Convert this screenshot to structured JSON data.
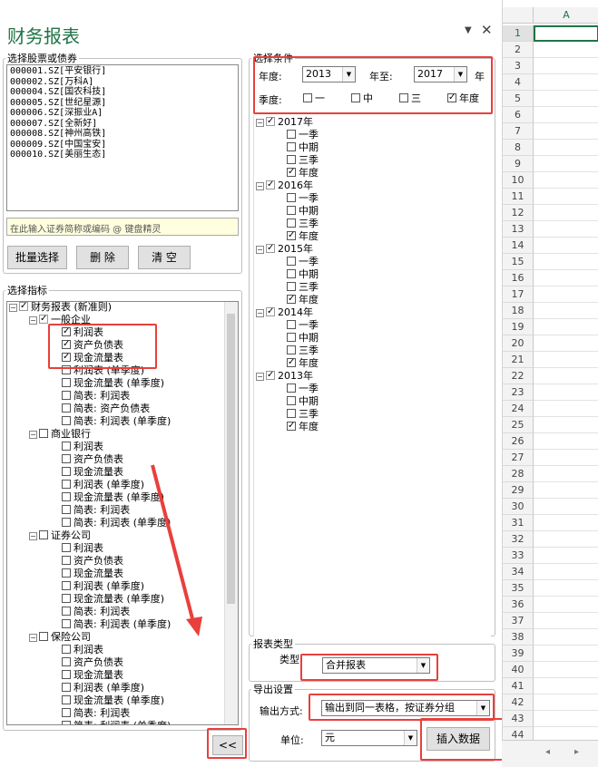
{
  "pane": {
    "title": "财务报表",
    "pin_icon": "▼",
    "close_icon": "✕"
  },
  "stock_group": {
    "legend": "选择股票或债券",
    "stocks": [
      "000001.SZ[平安银行]",
      "000002.SZ[万科A]",
      "000004.SZ[国农科技]",
      "000005.SZ[世纪星源]",
      "000006.SZ[深振业A]",
      "000007.SZ[全新好]",
      "000008.SZ[神州高铁]",
      "000009.SZ[中国宝安]",
      "000010.SZ[美丽生态]"
    ],
    "search_placeholder": "在此输入证券简称或编码 @ 键盘精灵",
    "batch_button": "批量选择",
    "delete_button": "删 除",
    "clear_button": "清 空"
  },
  "indicator_group": {
    "legend": "选择指标",
    "root": "财务报表 (新准则)",
    "sections": [
      {
        "name": "一般企业",
        "items": [
          {
            "label": "利润表",
            "checked": true
          },
          {
            "label": "资产负债表",
            "checked": true
          },
          {
            "label": "现金流量表",
            "checked": true
          },
          {
            "label": "利润表 (单季度)",
            "checked": false
          },
          {
            "label": "现金流量表 (单季度)",
            "checked": false
          },
          {
            "label": "简表: 利润表",
            "checked": false
          },
          {
            "label": "简表: 资产负债表",
            "checked": false
          },
          {
            "label": "简表: 利润表 (单季度)",
            "checked": false
          }
        ]
      },
      {
        "name": "商业银行",
        "items": [
          {
            "label": "利润表",
            "checked": false
          },
          {
            "label": "资产负债表",
            "checked": false
          },
          {
            "label": "现金流量表",
            "checked": false
          },
          {
            "label": "利润表 (单季度)",
            "checked": false
          },
          {
            "label": "现金流量表 (单季度)",
            "checked": false
          },
          {
            "label": "简表: 利润表",
            "checked": false
          },
          {
            "label": "简表: 利润表 (单季度)",
            "checked": false
          }
        ]
      },
      {
        "name": "证券公司",
        "items": [
          {
            "label": "利润表",
            "checked": false
          },
          {
            "label": "资产负债表",
            "checked": false
          },
          {
            "label": "现金流量表",
            "checked": false
          },
          {
            "label": "利润表 (单季度)",
            "checked": false
          },
          {
            "label": "现金流量表 (单季度)",
            "checked": false
          },
          {
            "label": "简表: 利润表",
            "checked": false
          },
          {
            "label": "简表: 利润表 (单季度)",
            "checked": false
          }
        ]
      },
      {
        "name": "保险公司",
        "items": [
          {
            "label": "利润表",
            "checked": false
          },
          {
            "label": "资产负债表",
            "checked": false
          },
          {
            "label": "现金流量表",
            "checked": false
          },
          {
            "label": "利润表 (单季度)",
            "checked": false
          },
          {
            "label": "现金流量表 (单季度)",
            "checked": false
          },
          {
            "label": "简表: 利润表",
            "checked": false
          },
          {
            "label": "简表: 利润表 (单季度)",
            "checked": false
          }
        ]
      }
    ],
    "collapse_button": "<<"
  },
  "conditions": {
    "legend": "选择条件",
    "year_from_label": "年度:",
    "year_from": "2013",
    "year_to_label": "年至:",
    "year_to": "2017",
    "year_suffix": "年",
    "season_label": "季度:",
    "seasons": [
      {
        "label": "一",
        "checked": false
      },
      {
        "label": "中",
        "checked": false
      },
      {
        "label": "三",
        "checked": false
      },
      {
        "label": "年度",
        "checked": true
      }
    ],
    "years": [
      {
        "year": "2017年",
        "periods": [
          {
            "label": "一季",
            "checked": false
          },
          {
            "label": "中期",
            "checked": false
          },
          {
            "label": "三季",
            "checked": false
          },
          {
            "label": "年度",
            "checked": true
          }
        ]
      },
      {
        "year": "2016年",
        "periods": [
          {
            "label": "一季",
            "checked": false
          },
          {
            "label": "中期",
            "checked": false
          },
          {
            "label": "三季",
            "checked": false
          },
          {
            "label": "年度",
            "checked": true
          }
        ]
      },
      {
        "year": "2015年",
        "periods": [
          {
            "label": "一季",
            "checked": false
          },
          {
            "label": "中期",
            "checked": false
          },
          {
            "label": "三季",
            "checked": false
          },
          {
            "label": "年度",
            "checked": true
          }
        ]
      },
      {
        "year": "2014年",
        "periods": [
          {
            "label": "一季",
            "checked": false
          },
          {
            "label": "中期",
            "checked": false
          },
          {
            "label": "三季",
            "checked": false
          },
          {
            "label": "年度",
            "checked": true
          }
        ]
      },
      {
        "year": "2013年",
        "periods": [
          {
            "label": "一季",
            "checked": false
          },
          {
            "label": "中期",
            "checked": false
          },
          {
            "label": "三季",
            "checked": false
          },
          {
            "label": "年度",
            "checked": true
          }
        ]
      }
    ]
  },
  "report_type": {
    "legend": "报表类型",
    "type_label": "类型:",
    "type_value": "合并报表"
  },
  "export": {
    "legend": "导出设置",
    "method_label": "输出方式:",
    "method_value": "输出到同一表格，按证券分组",
    "unit_label": "单位:",
    "unit_value": "元",
    "insert_button": "插入数据"
  },
  "sheet": {
    "column": "A",
    "rows": [
      "1",
      "2",
      "3",
      "4",
      "5",
      "6",
      "7",
      "8",
      "9",
      "10",
      "11",
      "12",
      "13",
      "14",
      "15",
      "16",
      "17",
      "18",
      "19",
      "20",
      "21",
      "22",
      "23",
      "24",
      "25",
      "26",
      "27",
      "28",
      "29",
      "30",
      "31",
      "32",
      "33",
      "34",
      "35",
      "36",
      "37",
      "38",
      "39",
      "40",
      "41",
      "42",
      "43",
      "44"
    ]
  },
  "colors": {
    "accent": "#217346",
    "highlight": "#e8403c"
  }
}
